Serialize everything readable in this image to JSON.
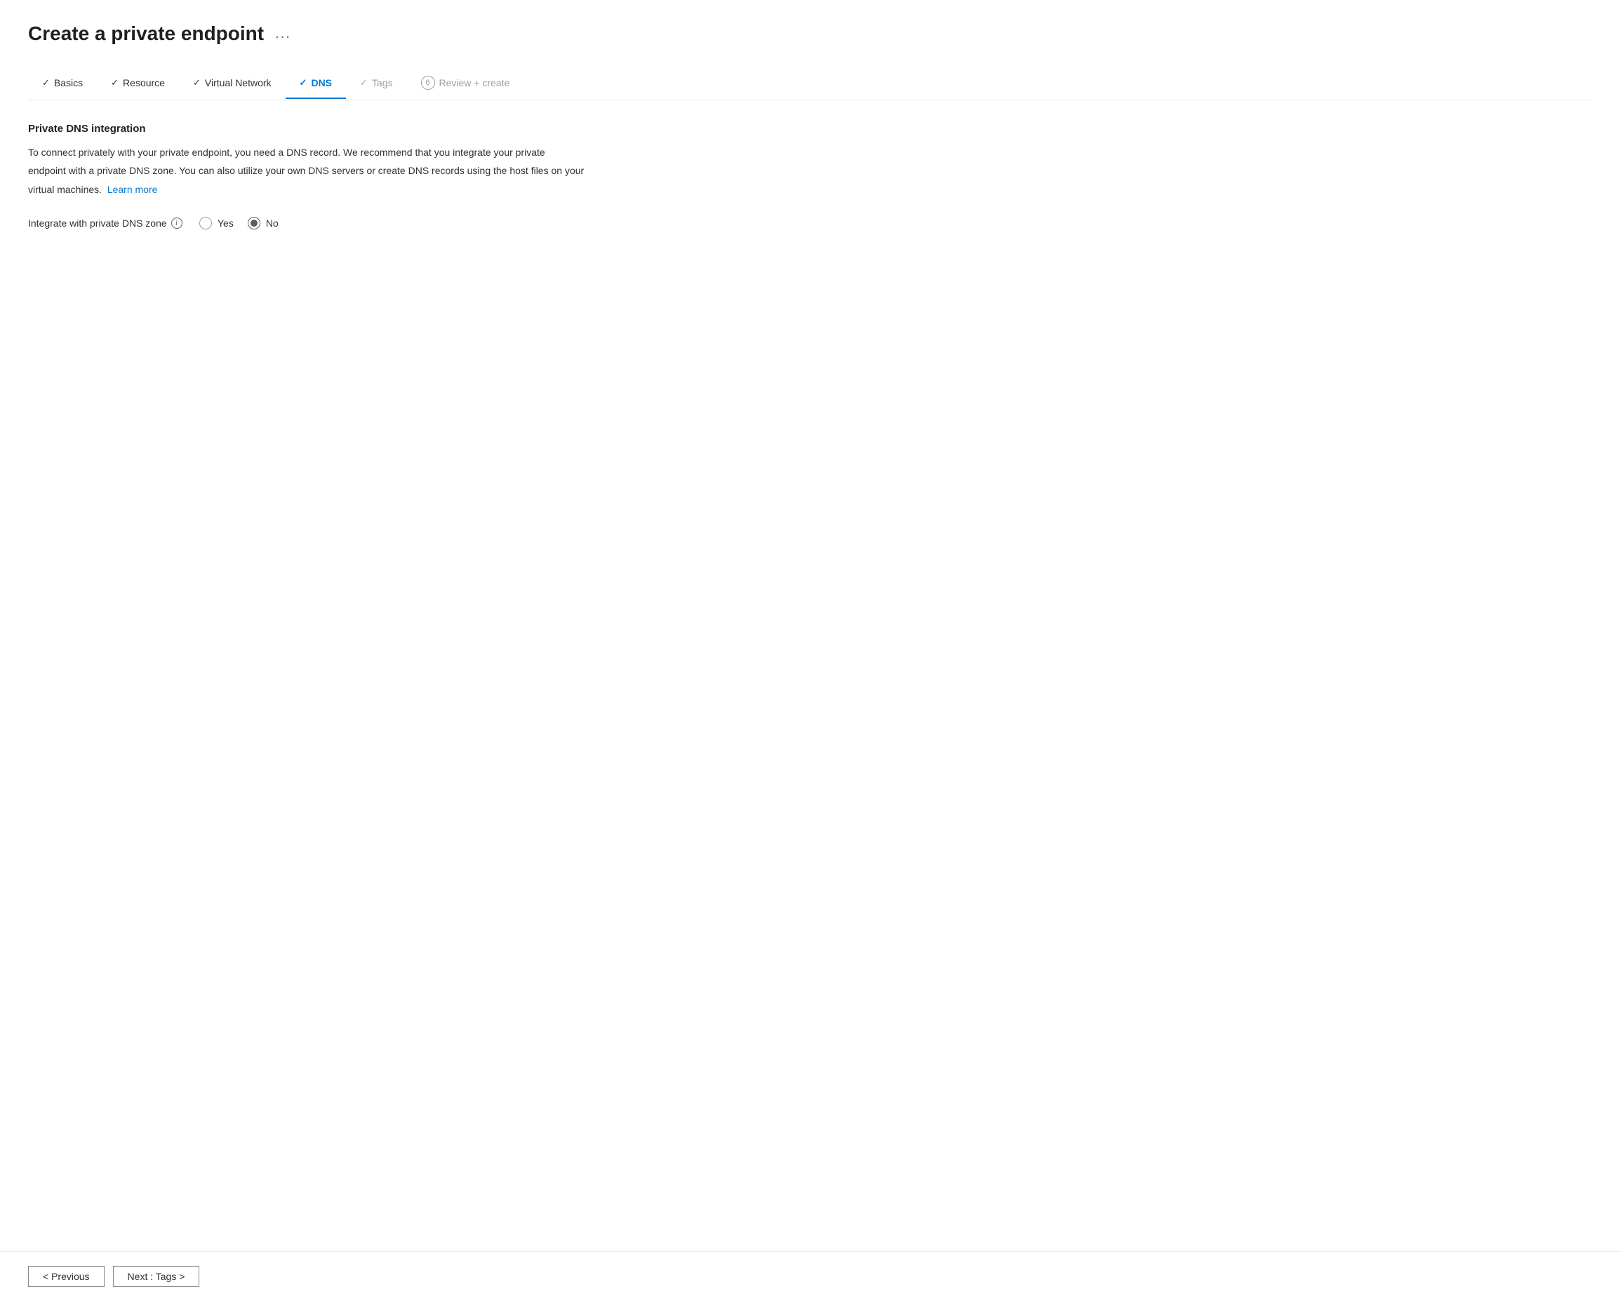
{
  "page": {
    "title": "Create a private endpoint",
    "ellipsis": "...",
    "wizard": {
      "steps": [
        {
          "id": "basics",
          "label": "Basics",
          "state": "completed",
          "icon": "✓",
          "number": null
        },
        {
          "id": "resource",
          "label": "Resource",
          "state": "completed",
          "icon": "✓",
          "number": null
        },
        {
          "id": "virtual-network",
          "label": "Virtual Network",
          "state": "completed",
          "icon": "✓",
          "number": null
        },
        {
          "id": "dns",
          "label": "DNS",
          "state": "active",
          "icon": "✓",
          "number": null
        },
        {
          "id": "tags",
          "label": "Tags",
          "state": "disabled",
          "icon": "✓",
          "number": null
        },
        {
          "id": "review-create",
          "label": "Review + create",
          "state": "disabled",
          "icon": null,
          "number": "6"
        }
      ]
    },
    "section": {
      "title": "Private DNS integration",
      "description_line1": "To connect privately with your private endpoint, you need a DNS record. We recommend that you integrate your private",
      "description_line2": "endpoint with a private DNS zone. You can also utilize your own DNS servers or create DNS records using the host files on your",
      "description_line3": "virtual machines.",
      "learn_more": "Learn more"
    },
    "field": {
      "label": "Integrate with private DNS zone",
      "info_icon": "i",
      "radio_options": [
        {
          "id": "yes",
          "label": "Yes",
          "selected": false
        },
        {
          "id": "no",
          "label": "No",
          "selected": true
        }
      ]
    },
    "footer": {
      "previous_label": "< Previous",
      "next_label": "Next : Tags >"
    }
  }
}
